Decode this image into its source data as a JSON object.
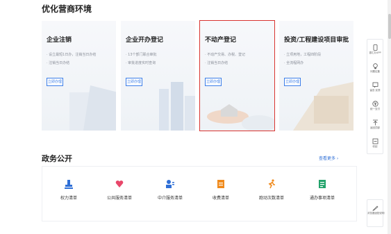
{
  "sections": {
    "environment_title": "优化营商环境",
    "government_title": "政务公开",
    "more_link": "查看更多 ›"
  },
  "cards": [
    {
      "title": "企业注销",
      "lines": [
        "· 设立最短1日办，注销当日办结",
        "· 注销当日办结"
      ],
      "button": "立即办理"
    },
    {
      "title": "企业开办登记",
      "lines": [
        "· 13个部门联合审批",
        "· 审批进度实时查询"
      ],
      "button": "立即办理"
    },
    {
      "title": "不动产登记",
      "lines": [
        "· 不动产交易、办税、登记",
        "· 注销当日办结"
      ],
      "button": "立即办理"
    },
    {
      "title": "投资/工程建设项目审批",
      "lines": [
        "· 立项用地，工程四阶段",
        "· 全流程网办"
      ],
      "button": "立即办理"
    }
  ],
  "gov_items": [
    {
      "label": "权力清单",
      "icon": "stamp-icon",
      "color": "#2f6fd6"
    },
    {
      "label": "公共服务清单",
      "icon": "heart-hands-icon",
      "color": "#e8476a"
    },
    {
      "label": "中介服务清单",
      "icon": "person-list-icon",
      "color": "#2f6fd6"
    },
    {
      "label": "收费清单",
      "icon": "fee-icon",
      "color": "#f08a1c"
    },
    {
      "label": "跑动次数清单",
      "icon": "running-icon",
      "color": "#f08a1c"
    },
    {
      "label": "通办事项清单",
      "icon": "document-list-icon",
      "color": "#22a36b"
    }
  ],
  "side_toolbar": [
    {
      "label": "银汇办APP",
      "icon": "phone-icon"
    },
    {
      "label": "问题征集",
      "icon": "bulb-icon"
    },
    {
      "label": "留言·反馈",
      "icon": "message-icon"
    },
    {
      "label": "统一支付",
      "icon": "yen-icon"
    },
    {
      "label": "返回顶部",
      "icon": "top-icon"
    },
    {
      "label": "收起",
      "icon": "collapse-icon"
    }
  ],
  "side_toolbar2": {
    "label": "浏览器适配说明",
    "icon": "browser-icon"
  }
}
